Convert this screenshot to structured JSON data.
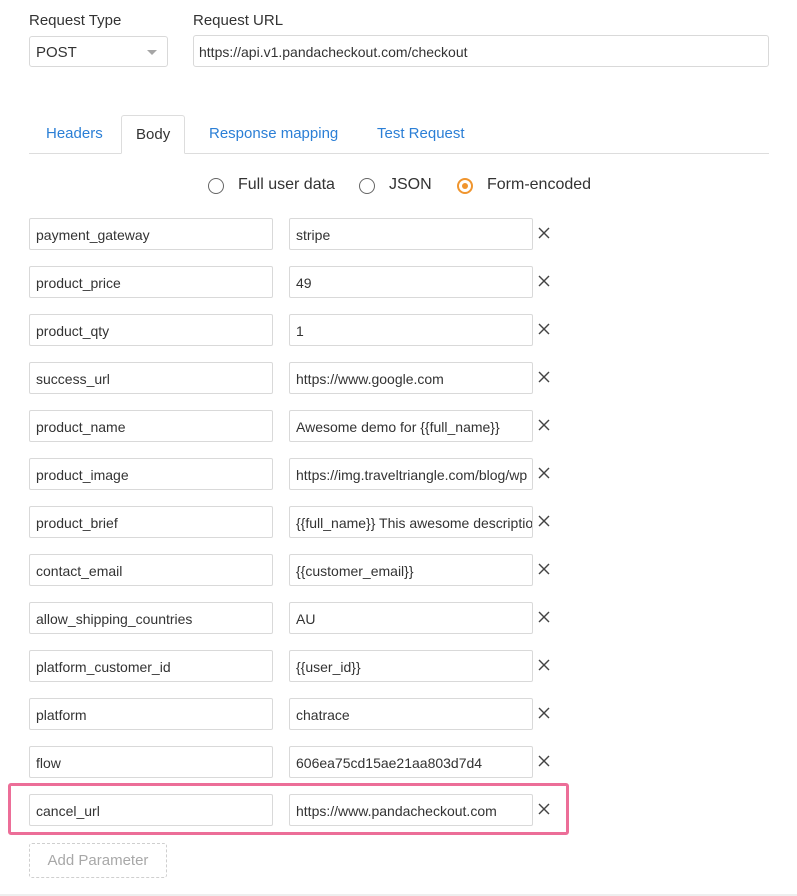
{
  "request_type": {
    "label": "Request Type",
    "value": "POST"
  },
  "request_url": {
    "label": "Request URL",
    "value": "https://api.v1.pandacheckout.com/checkout"
  },
  "tabs": [
    {
      "label": "Headers",
      "active": false
    },
    {
      "label": "Body",
      "active": true
    },
    {
      "label": "Response mapping",
      "active": false
    },
    {
      "label": "Test Request",
      "active": false
    }
  ],
  "body_format": {
    "options": [
      "Full user data",
      "JSON",
      "Form-encoded"
    ],
    "selected": "Form-encoded"
  },
  "parameters": [
    {
      "key": "payment_gateway",
      "value": "stripe"
    },
    {
      "key": "product_price",
      "value": "49"
    },
    {
      "key": "product_qty",
      "value": "1"
    },
    {
      "key": "success_url",
      "value": "https://www.google.com"
    },
    {
      "key": "product_name",
      "value": "Awesome demo for {{full_name}}"
    },
    {
      "key": "product_image",
      "value": "https://img.traveltriangle.com/blog/wp"
    },
    {
      "key": "product_brief",
      "value": "{{full_name}} This awesome descriptio"
    },
    {
      "key": "contact_email",
      "value": "{{customer_email}}"
    },
    {
      "key": "allow_shipping_countries",
      "value": "AU"
    },
    {
      "key": "platform_customer_id",
      "value": "{{user_id}}"
    },
    {
      "key": "platform",
      "value": "chatrace"
    },
    {
      "key": "flow",
      "value": "606ea75cd15ae21aa803d7d4"
    },
    {
      "key": "cancel_url",
      "value": "https://www.pandacheckout.com"
    }
  ],
  "add_parameter_label": "Add Parameter",
  "colors": {
    "tab_link": "#2b7fd6",
    "radio_selected": "#f0952e",
    "highlight_border": "#ec6e98"
  }
}
